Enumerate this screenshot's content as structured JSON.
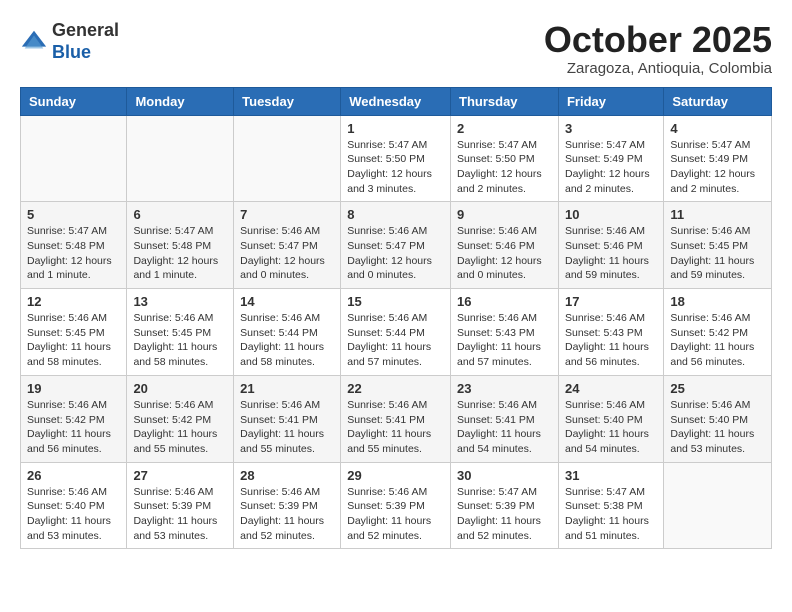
{
  "logo": {
    "general": "General",
    "blue": "Blue"
  },
  "header": {
    "title": "October 2025",
    "subtitle": "Zaragoza, Antioquia, Colombia"
  },
  "weekdays": [
    "Sunday",
    "Monday",
    "Tuesday",
    "Wednesday",
    "Thursday",
    "Friday",
    "Saturday"
  ],
  "weeks": [
    [
      {
        "day": "",
        "info": ""
      },
      {
        "day": "",
        "info": ""
      },
      {
        "day": "",
        "info": ""
      },
      {
        "day": "1",
        "info": "Sunrise: 5:47 AM\nSunset: 5:50 PM\nDaylight: 12 hours and 3 minutes."
      },
      {
        "day": "2",
        "info": "Sunrise: 5:47 AM\nSunset: 5:50 PM\nDaylight: 12 hours and 2 minutes."
      },
      {
        "day": "3",
        "info": "Sunrise: 5:47 AM\nSunset: 5:49 PM\nDaylight: 12 hours and 2 minutes."
      },
      {
        "day": "4",
        "info": "Sunrise: 5:47 AM\nSunset: 5:49 PM\nDaylight: 12 hours and 2 minutes."
      }
    ],
    [
      {
        "day": "5",
        "info": "Sunrise: 5:47 AM\nSunset: 5:48 PM\nDaylight: 12 hours and 1 minute."
      },
      {
        "day": "6",
        "info": "Sunrise: 5:47 AM\nSunset: 5:48 PM\nDaylight: 12 hours and 1 minute."
      },
      {
        "day": "7",
        "info": "Sunrise: 5:46 AM\nSunset: 5:47 PM\nDaylight: 12 hours and 0 minutes."
      },
      {
        "day": "8",
        "info": "Sunrise: 5:46 AM\nSunset: 5:47 PM\nDaylight: 12 hours and 0 minutes."
      },
      {
        "day": "9",
        "info": "Sunrise: 5:46 AM\nSunset: 5:46 PM\nDaylight: 12 hours and 0 minutes."
      },
      {
        "day": "10",
        "info": "Sunrise: 5:46 AM\nSunset: 5:46 PM\nDaylight: 11 hours and 59 minutes."
      },
      {
        "day": "11",
        "info": "Sunrise: 5:46 AM\nSunset: 5:45 PM\nDaylight: 11 hours and 59 minutes."
      }
    ],
    [
      {
        "day": "12",
        "info": "Sunrise: 5:46 AM\nSunset: 5:45 PM\nDaylight: 11 hours and 58 minutes."
      },
      {
        "day": "13",
        "info": "Sunrise: 5:46 AM\nSunset: 5:45 PM\nDaylight: 11 hours and 58 minutes."
      },
      {
        "day": "14",
        "info": "Sunrise: 5:46 AM\nSunset: 5:44 PM\nDaylight: 11 hours and 58 minutes."
      },
      {
        "day": "15",
        "info": "Sunrise: 5:46 AM\nSunset: 5:44 PM\nDaylight: 11 hours and 57 minutes."
      },
      {
        "day": "16",
        "info": "Sunrise: 5:46 AM\nSunset: 5:43 PM\nDaylight: 11 hours and 57 minutes."
      },
      {
        "day": "17",
        "info": "Sunrise: 5:46 AM\nSunset: 5:43 PM\nDaylight: 11 hours and 56 minutes."
      },
      {
        "day": "18",
        "info": "Sunrise: 5:46 AM\nSunset: 5:42 PM\nDaylight: 11 hours and 56 minutes."
      }
    ],
    [
      {
        "day": "19",
        "info": "Sunrise: 5:46 AM\nSunset: 5:42 PM\nDaylight: 11 hours and 56 minutes."
      },
      {
        "day": "20",
        "info": "Sunrise: 5:46 AM\nSunset: 5:42 PM\nDaylight: 11 hours and 55 minutes."
      },
      {
        "day": "21",
        "info": "Sunrise: 5:46 AM\nSunset: 5:41 PM\nDaylight: 11 hours and 55 minutes."
      },
      {
        "day": "22",
        "info": "Sunrise: 5:46 AM\nSunset: 5:41 PM\nDaylight: 11 hours and 55 minutes."
      },
      {
        "day": "23",
        "info": "Sunrise: 5:46 AM\nSunset: 5:41 PM\nDaylight: 11 hours and 54 minutes."
      },
      {
        "day": "24",
        "info": "Sunrise: 5:46 AM\nSunset: 5:40 PM\nDaylight: 11 hours and 54 minutes."
      },
      {
        "day": "25",
        "info": "Sunrise: 5:46 AM\nSunset: 5:40 PM\nDaylight: 11 hours and 53 minutes."
      }
    ],
    [
      {
        "day": "26",
        "info": "Sunrise: 5:46 AM\nSunset: 5:40 PM\nDaylight: 11 hours and 53 minutes."
      },
      {
        "day": "27",
        "info": "Sunrise: 5:46 AM\nSunset: 5:39 PM\nDaylight: 11 hours and 53 minutes."
      },
      {
        "day": "28",
        "info": "Sunrise: 5:46 AM\nSunset: 5:39 PM\nDaylight: 11 hours and 52 minutes."
      },
      {
        "day": "29",
        "info": "Sunrise: 5:46 AM\nSunset: 5:39 PM\nDaylight: 11 hours and 52 minutes."
      },
      {
        "day": "30",
        "info": "Sunrise: 5:47 AM\nSunset: 5:39 PM\nDaylight: 11 hours and 52 minutes."
      },
      {
        "day": "31",
        "info": "Sunrise: 5:47 AM\nSunset: 5:38 PM\nDaylight: 11 hours and 51 minutes."
      },
      {
        "day": "",
        "info": ""
      }
    ]
  ]
}
